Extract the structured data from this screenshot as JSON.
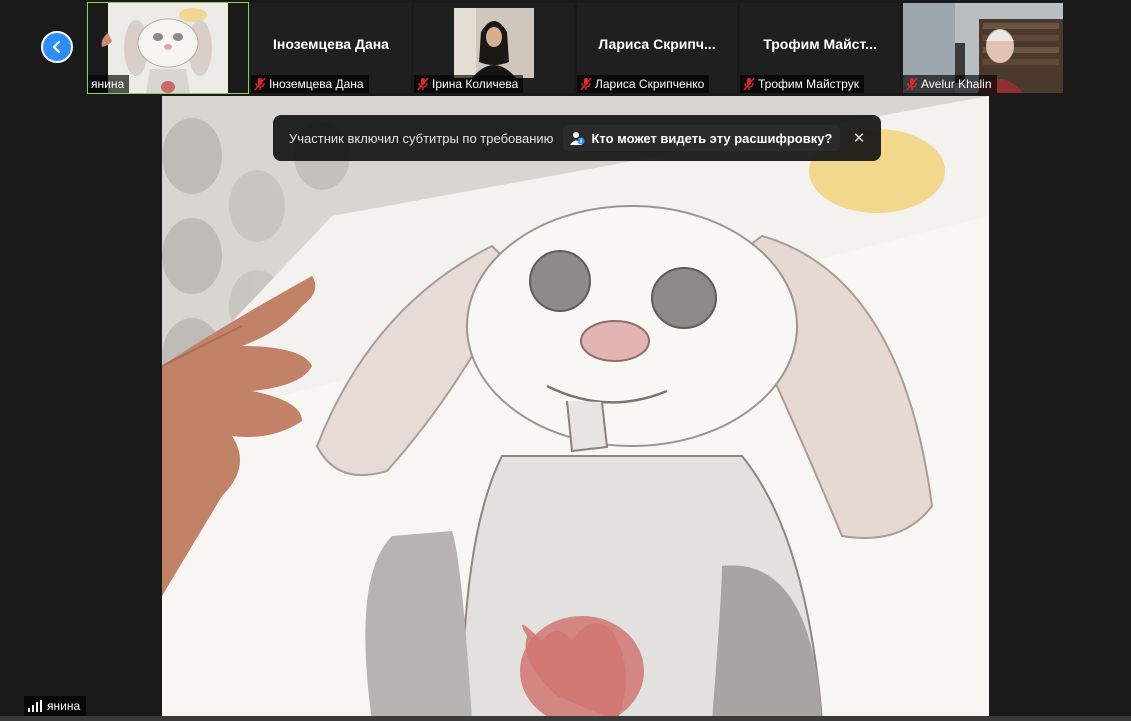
{
  "participants": [
    {
      "id": "yanina",
      "name": "янина",
      "has_video": true,
      "active": true
    },
    {
      "id": "dana",
      "name": "Іноземцева Дана",
      "display_title": "Іноземцева Дана",
      "muted": true,
      "has_video": false
    },
    {
      "id": "iryna",
      "name": "Ірина Количева",
      "muted": true,
      "has_video": true
    },
    {
      "id": "larysa",
      "name": "Лариса Скрипченко",
      "display_title": "Лариса  Скрипч...",
      "muted": true,
      "has_video": false
    },
    {
      "id": "trofym",
      "name": "Трофим Майструк",
      "display_title": "Трофим  Майст...",
      "muted": true,
      "has_video": false
    },
    {
      "id": "avelur",
      "name": "Avelur Khalin",
      "muted": true,
      "has_video": true
    }
  ],
  "caption_banner": {
    "message": "Участник включил субтитры по требованию",
    "link_label": "Кто может видеть эту расшифровку?",
    "close_glyph": "✕"
  },
  "main_speaker": {
    "name": "янина"
  },
  "colors": {
    "accent": "#2d8cff",
    "active_border": "#8fd14f",
    "mute_red": "#e02828"
  }
}
